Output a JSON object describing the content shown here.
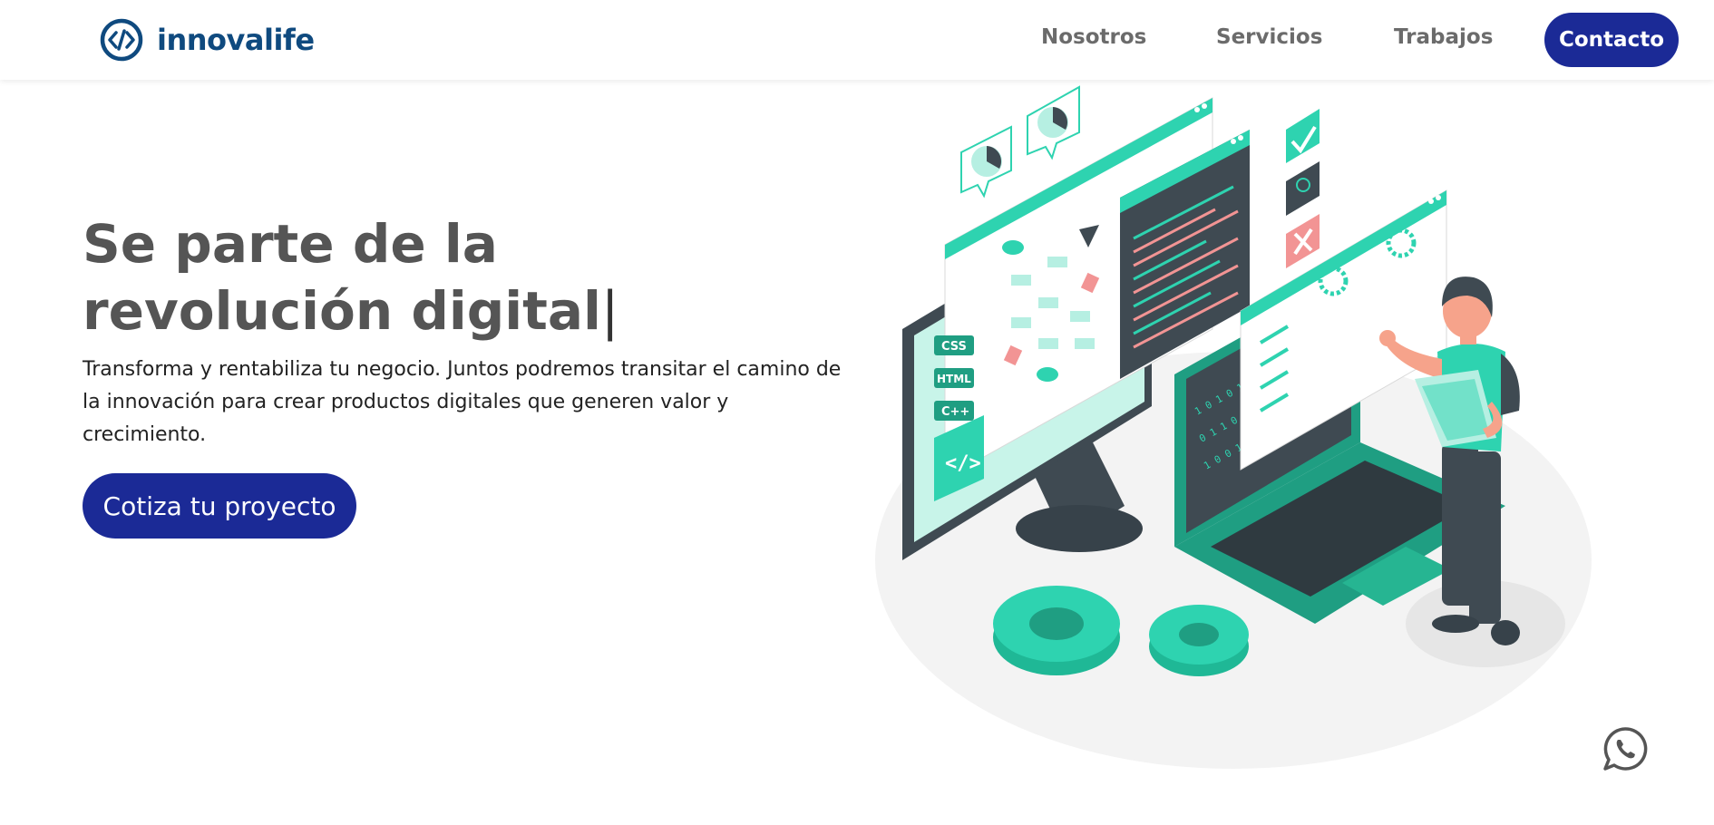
{
  "brand": {
    "name": "innovalife",
    "logo_icon": "code-brackets-icon",
    "color": "#0f4a7f"
  },
  "nav": {
    "items": [
      {
        "label": "Nosotros"
      },
      {
        "label": "Servicios"
      },
      {
        "label": "Trabajos"
      }
    ],
    "contact_label": "Contacto"
  },
  "hero": {
    "title_line1": "Se parte de la",
    "title_line2": "revolución digital",
    "caret": "|",
    "description": "Transforma y rentabiliza tu negocio. Juntos podremos transitar el camino de la innovación para crear productos digitales que generen valor y crecimiento.",
    "cta_label": "Cotiza tu proyecto"
  },
  "illustration": {
    "labels": [
      "CSS",
      "HTML",
      "C++"
    ],
    "accent": "#2ed3b0"
  },
  "colors": {
    "primary": "#1b2a96",
    "text_gray": "#555555",
    "accent": "#2ed3b0"
  },
  "floating": {
    "icon": "whatsapp-icon"
  }
}
